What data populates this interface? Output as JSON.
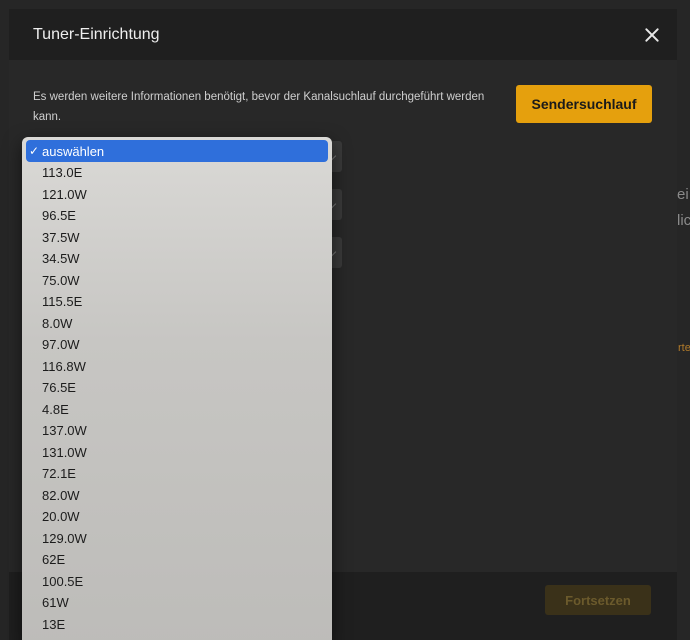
{
  "modal": {
    "title": "Tuner-Einrichtung",
    "info_text": "Es werden weitere Informationen benötigt, bevor der Kanalsuchlauf durchgeführt werden kann.",
    "scan_button": "Sendersuchlauf",
    "continue_button": "Fortsetzen"
  },
  "background": {
    "peek_1": "ei",
    "peek_2": "lic",
    "peek_3": "rte"
  },
  "dropdown": {
    "selected": "auswählen",
    "check": "✓",
    "options": [
      "113.0E",
      "121.0W",
      "96.5E",
      "37.5W",
      "34.5W",
      "75.0W",
      "115.5E",
      "8.0W",
      "97.0W",
      "116.8W",
      "76.5E",
      "4.8E",
      "137.0W",
      "131.0W",
      "72.1E",
      "82.0W",
      "20.0W",
      "129.0W",
      "62E",
      "100.5E",
      "61W",
      "13E"
    ]
  },
  "colors": {
    "accent": "#e5a00d",
    "selection": "#2f6fdb",
    "header": "#1f1f1f",
    "body": "#282828"
  }
}
